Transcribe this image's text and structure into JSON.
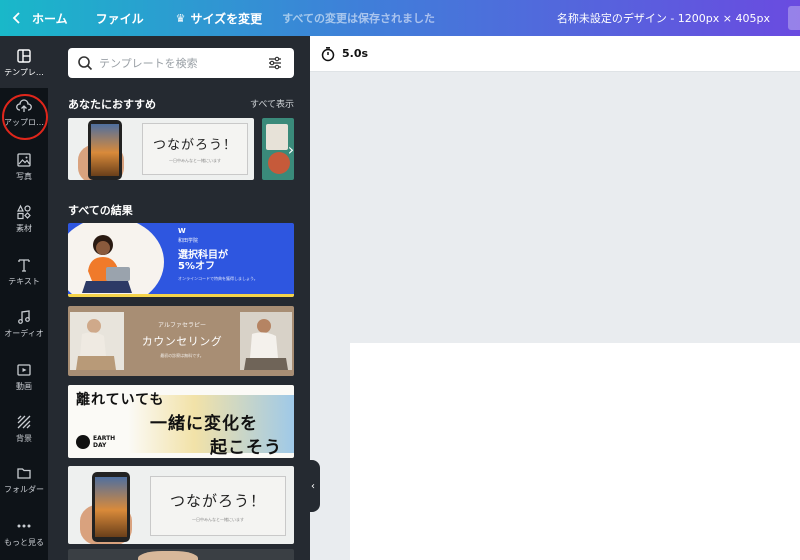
{
  "topbar": {
    "home": "ホーム",
    "file": "ファイル",
    "resize": "サイズを変更",
    "saved_status": "すべての変更は保存されました",
    "doc_title": "名称未設定のデザイン - 1200px × 405px"
  },
  "rail": {
    "items": [
      {
        "label": "テンプレ…",
        "icon": "template-icon"
      },
      {
        "label": "アップロ…",
        "icon": "upload-cloud-icon"
      },
      {
        "label": "写真",
        "icon": "photo-icon"
      },
      {
        "label": "素材",
        "icon": "elements-icon"
      },
      {
        "label": "テキスト",
        "icon": "text-icon"
      },
      {
        "label": "オーディオ",
        "icon": "music-note-icon"
      },
      {
        "label": "動画",
        "icon": "video-play-icon"
      },
      {
        "label": "背景",
        "icon": "background-pattern-icon"
      },
      {
        "label": "フォルダー",
        "icon": "folder-icon"
      },
      {
        "label": "もっと見る",
        "icon": "more-dots-icon"
      }
    ]
  },
  "panel": {
    "search_placeholder": "テンプレートを検索",
    "recommended_title": "あなたにおすすめ",
    "show_all": "すべて表示",
    "all_results_title": "すべての結果",
    "rec_card_text": "つながろう！",
    "rec_card_sub": "一日中みんなと一緒にいます",
    "result1": {
      "brand": "W",
      "school": "和田学院",
      "main_line1": "選択科目が",
      "main_line2": "5%オフ",
      "small": "オンラインコードで特典を獲得しましょう。"
    },
    "result2": {
      "kicker": "アルファセラピー",
      "main": "カウンセリング",
      "small": "最初の診察は無料です。"
    },
    "result3": {
      "line1": "離れていても",
      "line2": "一緒に変化を",
      "line3": "起こそう",
      "earth_line1": "EARTH",
      "earth_line2": "DAY"
    },
    "result4": {
      "main": "つながろう！",
      "sub": "一日中みんなと一緒にいます"
    }
  },
  "editor": {
    "duration": "5.0s"
  },
  "colors": {
    "topbar_gradient": [
      "#19b8c9",
      "#3f7fd9",
      "#6a4be0"
    ],
    "rail_bg": "#0e1318",
    "panel_bg": "#252a31",
    "annotation_circle": "#e0261b",
    "canvas_bg": "#e9ecef"
  }
}
